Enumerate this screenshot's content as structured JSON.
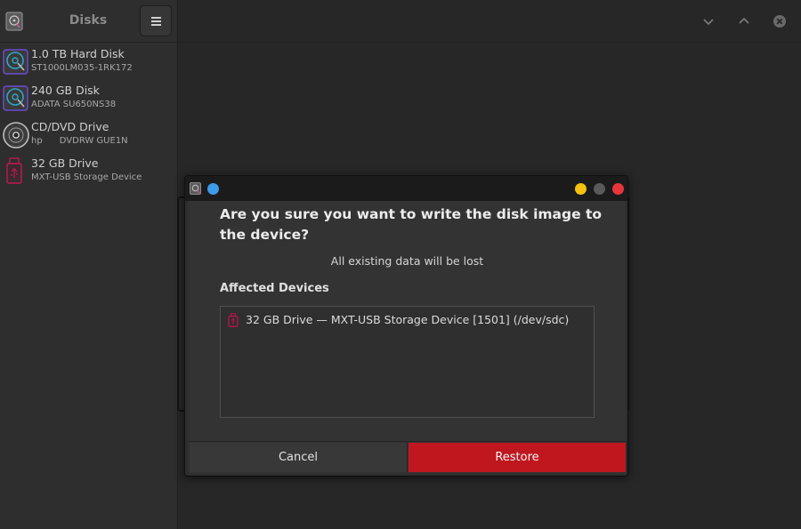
{
  "sidebar": {
    "title": "Disks",
    "items": [
      {
        "name": "1.0 TB Hard Disk",
        "sub": "ST1000LM035-1RK172",
        "icon": "hard-disk-icon"
      },
      {
        "name": "240 GB Disk",
        "sub": "ADATA SU650NS38",
        "icon": "hard-disk-icon"
      },
      {
        "name": "CD/DVD Drive",
        "sub": "hp      DVDRW GUE1N",
        "icon": "optical-disc-icon"
      },
      {
        "name": "32 GB Drive",
        "sub": "MXT-USB Storage Device",
        "icon": "usb-drive-icon"
      }
    ]
  },
  "header": {
    "controls": [
      "chevron-down-icon",
      "chevron-up-icon",
      "close-icon"
    ]
  },
  "dialog": {
    "heading": "Are you sure you want to write the disk image to the device?",
    "subtext": "All existing data will be lost",
    "section_label": "Affected Devices",
    "devices": [
      {
        "label": "32 GB Drive — MXT-USB Storage Device [1501] (/dev/sdc)",
        "icon": "usb-drive-icon"
      }
    ],
    "cancel_label": "Cancel",
    "restore_label": "Restore",
    "window_dots": {
      "left": "#3d9be9",
      "minimize": "#f3c10e",
      "maximize": "#5a5a5a",
      "close": "#e8353b"
    }
  },
  "colors": {
    "accent_destructive": "#c0171f",
    "disk_icon_primary": "#6a4bd0",
    "disk_icon_secondary": "#2fa6c8",
    "usb_icon": "#c2184e"
  }
}
